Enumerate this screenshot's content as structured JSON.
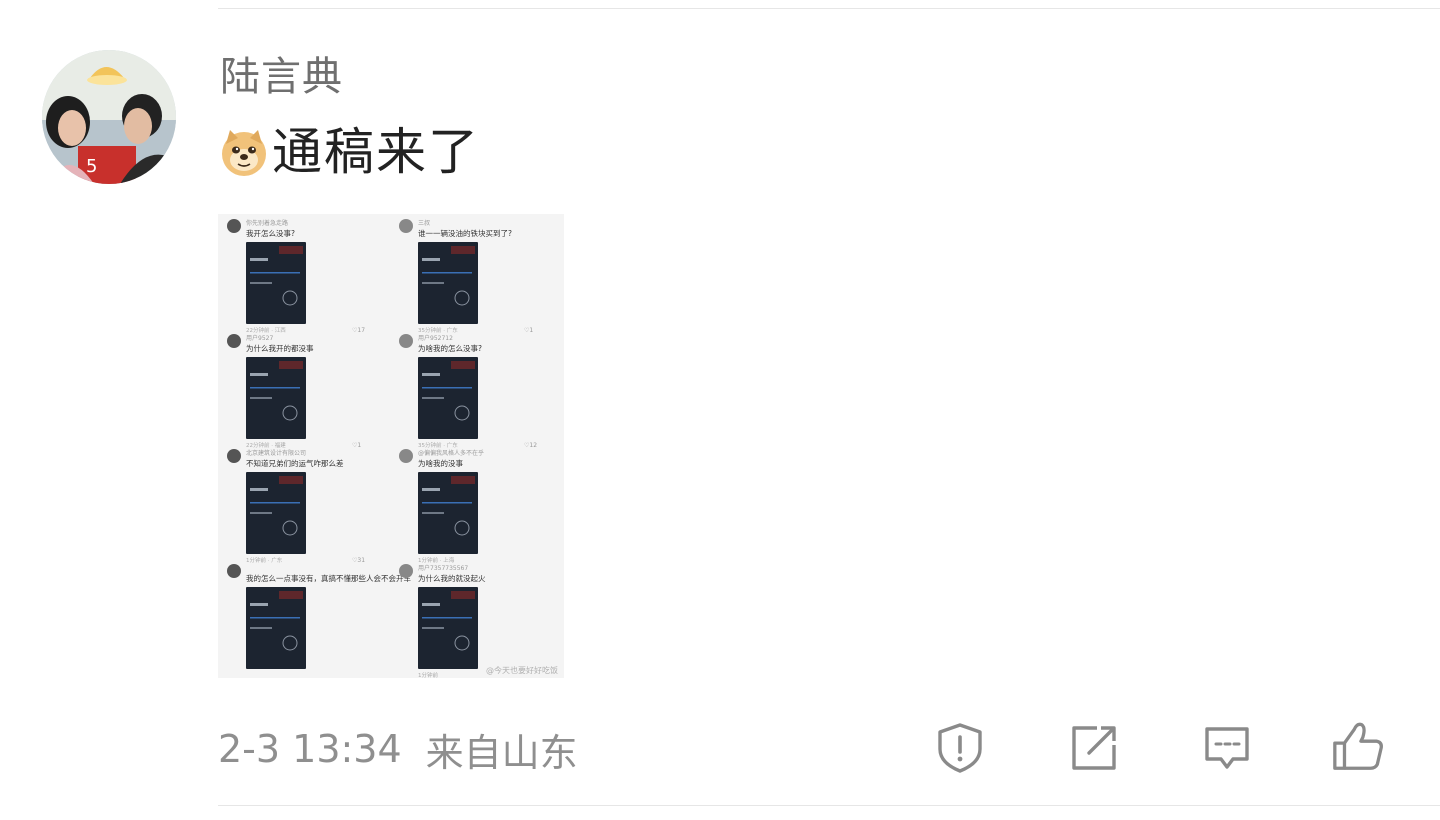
{
  "comment": {
    "username": "陆言典",
    "emoji": "doge-emoji",
    "text": "通稿来了",
    "time": "2-3 13:34",
    "location": "来自山东",
    "attachment": {
      "type": "image",
      "description_icon": "screenshot-collage",
      "watermark": "@今天也要好好吃饭",
      "panels": [
        {
          "user": "你先别着急走路",
          "text": "我开怎么没事?",
          "footer_time": "22分钟前",
          "footer_location": "江西",
          "likes": "17"
        },
        {
          "user": "三叔",
          "text": "谁一一辆没油的铁块买到了?",
          "footer_time": "35分钟前",
          "footer_location": "广东",
          "likes": "1"
        },
        {
          "user": "用户9527",
          "text": "为什么我开的都没事",
          "footer_time": "22分钟前",
          "footer_location": "福建",
          "likes": "1"
        },
        {
          "user": "用户952712",
          "text": "为啥我的怎么没事?",
          "footer_time": "35分钟前",
          "footer_location": "广东",
          "likes": "12"
        },
        {
          "user": "北京建筑设计有限公司",
          "text": "不知道兄弟们的运气咋那么差",
          "footer_time": "1分钟前",
          "footer_location": "广东",
          "likes": "31"
        },
        {
          "user": "@偏偏我风格人多不在乎",
          "text": "为啥我的没事",
          "footer_time": "1分钟前",
          "footer_location": "上海",
          "likes": ""
        },
        {
          "user": "",
          "text": "我的怎么一点事没有，真搞不懂那些人会不会开车",
          "footer_time": "",
          "footer_location": "",
          "likes": ""
        },
        {
          "user": "用户7357735567",
          "text": "为什么我的就没起火",
          "footer_time": "1分钟前",
          "footer_location": "",
          "likes": ""
        }
      ]
    }
  },
  "actions": [
    {
      "name": "report-icon"
    },
    {
      "name": "share-icon"
    },
    {
      "name": "comment-icon"
    },
    {
      "name": "like-icon"
    }
  ],
  "colors": {
    "username": "#6f6f6f",
    "text": "#222222",
    "meta": "#8f8f8f",
    "icon": "#8a8a8a"
  }
}
